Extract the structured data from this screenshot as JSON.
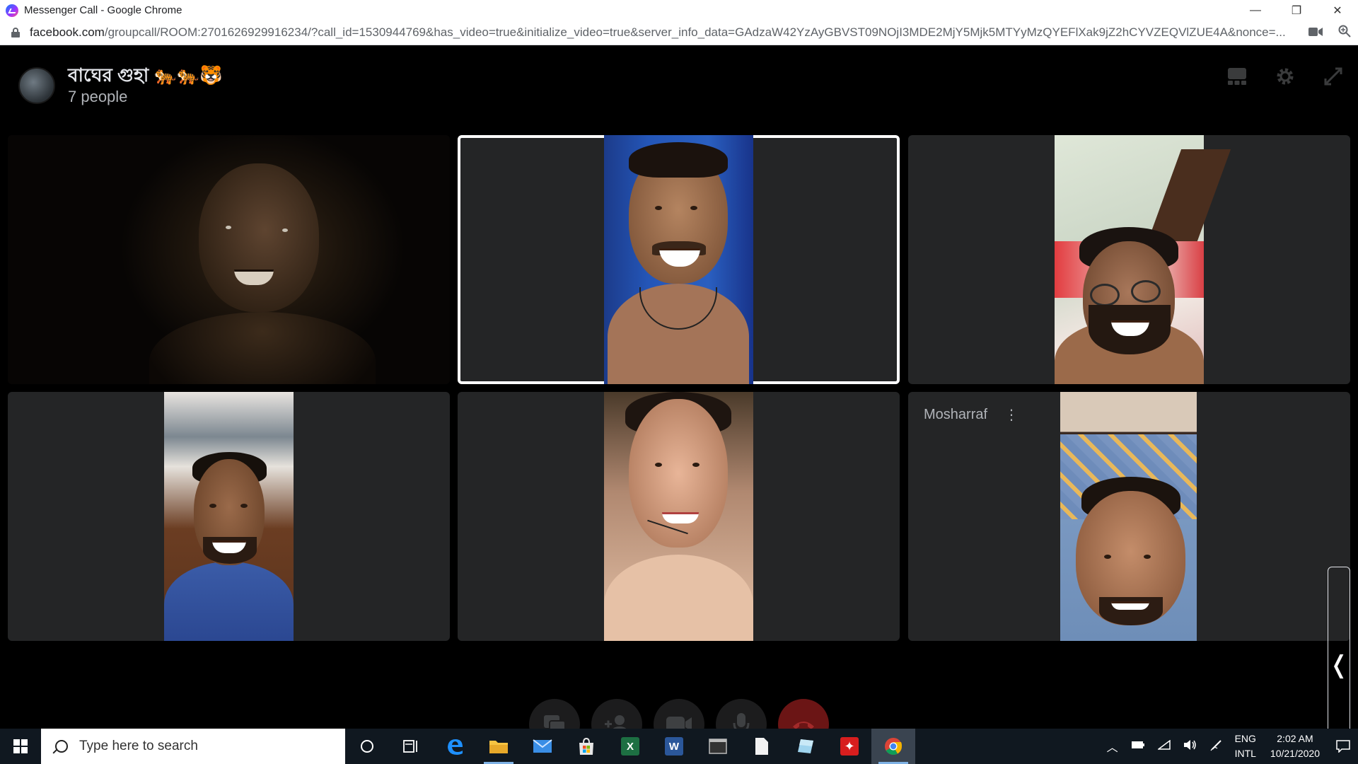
{
  "window": {
    "title": "Messenger Call - Google Chrome",
    "controls": {
      "minimize": "—",
      "restore": "❐",
      "close": "✕"
    }
  },
  "address_bar": {
    "domain": "facebook.com",
    "path": "/groupcall/ROOM:2701626929916234/?call_id=1530944769&has_video=true&initialize_video=true&server_info_data=GAdzaW42YzAyGBVST09NOjI3MDE2MjY5Mjk5MTYyMzQYEFlXak9jZ2hCYVZEQVlZUE4A&nonce=..."
  },
  "call": {
    "group_name": "বাঘের গুহা 🐅🐅🐯",
    "participants_count": "7 people",
    "labeled_participant": "Mosharraf",
    "more_icon": "⋮",
    "collapse_handle": "❬"
  },
  "controls": {
    "share_screen": "share-screen-icon",
    "add_person": "add-person-icon",
    "camera": "camera-icon",
    "mic": "microphone-icon",
    "end_call": "end-call-icon"
  },
  "taskbar": {
    "search_placeholder": "Type here to search",
    "lang_top": "ENG",
    "lang_bottom": "INTL",
    "time": "2:02 AM",
    "date": "10/21/2020"
  },
  "colors": {
    "tile_bg": "#242526",
    "active_border": "#ffffff",
    "end_call": "#6b1515",
    "taskbar": "#101820"
  }
}
